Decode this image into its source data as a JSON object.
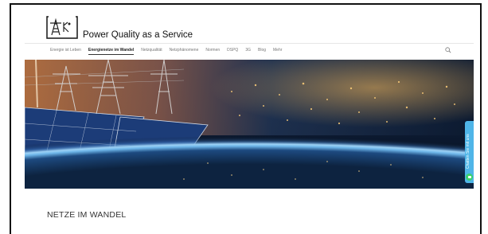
{
  "brand": {
    "name": "Power Quality as a Service"
  },
  "nav": {
    "items": [
      {
        "label": "Energie ist Leben"
      },
      {
        "label": "Energienetze im Wandel"
      },
      {
        "label": "Netzqualität"
      },
      {
        "label": "Netzphänomene"
      },
      {
        "label": "Normen"
      },
      {
        "label": "DSPQ"
      },
      {
        "label": "3G"
      },
      {
        "label": "Blog"
      },
      {
        "label": "Mehr"
      }
    ],
    "active_index": 1,
    "search_icon": "search-icon"
  },
  "hero": {
    "image": "earth-at-night-with-power-lines-and-solar-panels"
  },
  "section": {
    "title": "NETZE IM WANDEL"
  },
  "chat": {
    "label": "Chatten Sie mit uns",
    "icon": "chat-icon",
    "color": "#4fb5e8",
    "badge_color": "#3bd16f"
  }
}
